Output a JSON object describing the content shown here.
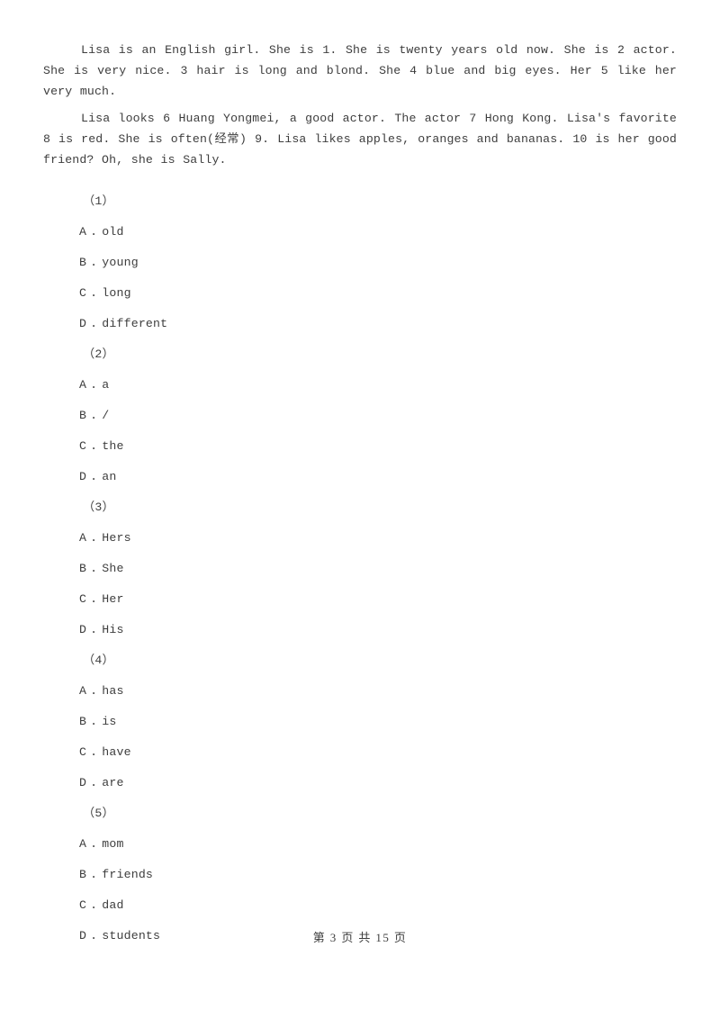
{
  "document": {
    "passages": [
      "Lisa is an English girl. She is 1. She is twenty years old now. She is 2 actor. She is very nice. 3 hair is long and blond. She 4 blue and big eyes. Her 5 like her very much.",
      "Lisa looks 6  Huang Yongmei, a good actor. The actor 7 Hong Kong. Lisa's favorite 8 is red. She is often(经常) 9. Lisa likes apples, oranges and bananas. 10 is her good friend? Oh, she is Sally."
    ],
    "questions": [
      {
        "number": "（1）",
        "options": [
          {
            "letter": "A",
            "sep": ".",
            "text": "old"
          },
          {
            "letter": "B",
            "sep": ".",
            "text": "young"
          },
          {
            "letter": "C",
            "sep": ".",
            "text": "long"
          },
          {
            "letter": "D",
            "sep": ".",
            "text": "different"
          }
        ]
      },
      {
        "number": "（2）",
        "options": [
          {
            "letter": "A",
            "sep": ".",
            "text": "a"
          },
          {
            "letter": "B",
            "sep": ".",
            "text": "/"
          },
          {
            "letter": "C",
            "sep": ".",
            "text": "the"
          },
          {
            "letter": "D",
            "sep": ".",
            "text": "an"
          }
        ]
      },
      {
        "number": "（3）",
        "options": [
          {
            "letter": "A",
            "sep": ".",
            "text": "Hers"
          },
          {
            "letter": "B",
            "sep": ".",
            "text": "She"
          },
          {
            "letter": "C",
            "sep": ".",
            "text": "Her"
          },
          {
            "letter": "D",
            "sep": ".",
            "text": "His"
          }
        ]
      },
      {
        "number": "（4）",
        "options": [
          {
            "letter": "A",
            "sep": ".",
            "text": "has"
          },
          {
            "letter": "B",
            "sep": ".",
            "text": "is"
          },
          {
            "letter": "C",
            "sep": ".",
            "text": "have"
          },
          {
            "letter": "D",
            "sep": ".",
            "text": "are"
          }
        ]
      },
      {
        "number": "（5）",
        "options": [
          {
            "letter": "A",
            "sep": ".",
            "text": "mom"
          },
          {
            "letter": "B",
            "sep": ".",
            "text": "friends"
          },
          {
            "letter": "C",
            "sep": ".",
            "text": "dad"
          },
          {
            "letter": "D",
            "sep": ".",
            "text": "students"
          }
        ]
      }
    ],
    "footer": "第 3 页 共 15 页"
  }
}
